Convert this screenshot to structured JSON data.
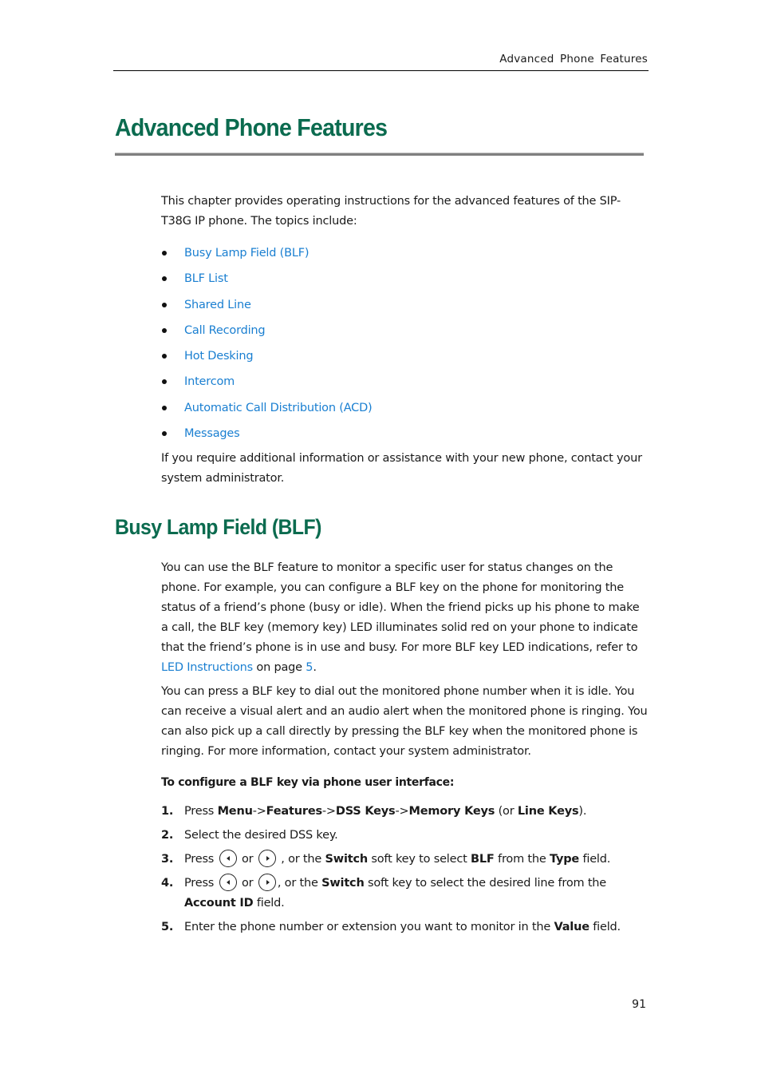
{
  "header": {
    "running_title": "Advanced Phone Features"
  },
  "chapter": {
    "title": "Advanced Phone Features",
    "intro": "This chapter provides operating instructions for the advanced features of the SIP-T38G IP phone. The topics include:",
    "topics": [
      "Busy Lamp Field (BLF)",
      "BLF List",
      "Shared Line",
      "Call Recording",
      "Hot Desking",
      "Intercom",
      "Automatic Call Distribution (ACD)",
      "Messages"
    ],
    "outro": "If you require additional information or assistance with your new phone, contact your system administrator."
  },
  "section": {
    "title": "Busy Lamp Field (BLF)",
    "para1_text": "You can use the BLF feature to monitor a specific user for status changes on the phone. For example, you can configure a BLF key on the phone for monitoring the status of a friend’s phone (busy or idle). When the friend picks up his phone to make a call, the BLF key (memory key) LED illuminates solid red on your phone to indicate that the friend’s phone is in use and busy. For more BLF key LED indications, refer to ",
    "para1_link": "LED Instructions",
    "para1_mid": " on page ",
    "para1_page_link": "5",
    "para1_end": ".",
    "para2": "You can press a BLF key to dial out the monitored phone number when it is idle. You can receive a visual alert and an audio alert when the monitored phone is ringing. You can also pick up a call directly by pressing the BLF key when the monitored phone is ringing. For more information, contact your system administrator.",
    "procedure_heading": "To configure a BLF key via phone user interface:",
    "steps": [
      {
        "num": "1.",
        "press": "Press ",
        "menu": "Menu",
        "a1": "->",
        "features": "Features",
        "a2": "->",
        "dss": "DSS Keys",
        "a3": "->",
        "memory": "Memory Keys",
        "or": " (or ",
        "line": "Line Keys",
        "end": ")."
      },
      {
        "num": "2.",
        "text": "Select the desired DSS key."
      },
      {
        "num": "3.",
        "press": "Press ",
        "or": " or ",
        "mid": " , or the ",
        "switch": "Switch",
        "mid2": " soft key to select ",
        "blf": "BLF",
        "mid3": " from the ",
        "type": "Type",
        "end": " field."
      },
      {
        "num": "4.",
        "press": "Press ",
        "or": " or ",
        "mid": ", or the ",
        "switch": "Switch",
        "mid2": " soft key to select the desired line from the ",
        "account": "Account ID",
        "end": " field."
      },
      {
        "num": "5.",
        "text": "Enter the phone number or extension you want to monitor in the ",
        "value": "Value",
        "end": " field."
      }
    ],
    "icons": {
      "left_key": "navigation-left-key-icon",
      "right_key": "navigation-right-key-icon"
    }
  },
  "footer": {
    "page_number": "91"
  }
}
